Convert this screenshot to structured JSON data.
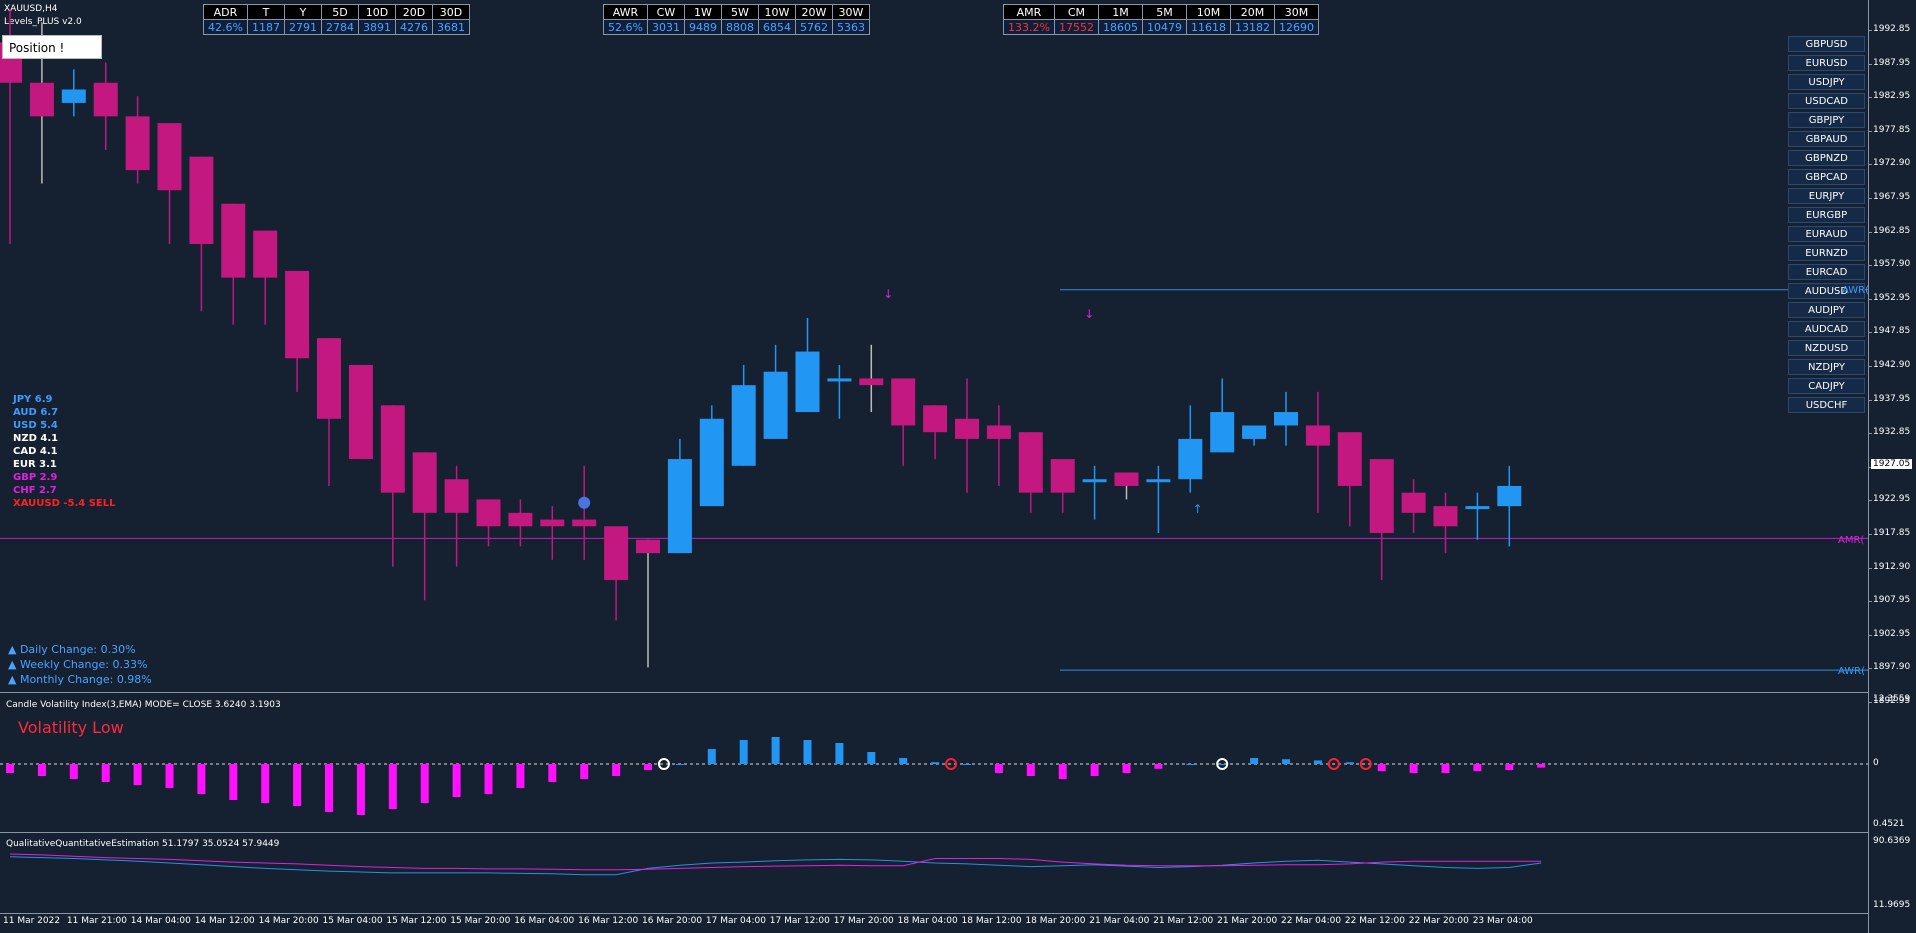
{
  "window": {
    "symbol_title": "XAUUSD,H4",
    "indicator_name": "Levels_PLUS v2.0"
  },
  "position_button": "Position !",
  "tables": {
    "daily": {
      "headers": [
        "ADR",
        "T",
        "Y",
        "5D",
        "10D",
        "20D",
        "30D"
      ],
      "values": [
        "42.6%",
        "1187",
        "2791",
        "2784",
        "3891",
        "4276",
        "3681"
      ]
    },
    "weekly": {
      "headers": [
        "AWR",
        "CW",
        "1W",
        "5W",
        "10W",
        "20W",
        "30W"
      ],
      "values": [
        "52.6%",
        "3031",
        "9489",
        "8808",
        "6854",
        "5762",
        "5363"
      ]
    },
    "monthly": {
      "headers": [
        "AMR",
        "CM",
        "1M",
        "5M",
        "10M",
        "20M",
        "30M"
      ],
      "values": [
        "133.2%",
        "17552",
        "18605",
        "10479",
        "11618",
        "13182",
        "12690"
      ]
    }
  },
  "pairs": [
    "GBPUSD",
    "EURUSD",
    "USDJPY",
    "USDCAD",
    "GBPJPY",
    "GBPAUD",
    "GBPNZD",
    "GBPCAD",
    "EURJPY",
    "EURGBP",
    "EURAUD",
    "EURNZD",
    "EURCAD",
    "AUDUSD",
    "AUDJPY",
    "AUDCAD",
    "NZDUSD",
    "NZDJPY",
    "CADJPY",
    "USDCHF"
  ],
  "strength": [
    {
      "label": "JPY  6.9",
      "color": "#3d9bff"
    },
    {
      "label": "AUD  6.7",
      "color": "#3d9bff"
    },
    {
      "label": "USD  5.4",
      "color": "#3d9bff"
    },
    {
      "label": "NZD  4.1",
      "color": "#ffffff"
    },
    {
      "label": "CAD  4.1",
      "color": "#ffffff"
    },
    {
      "label": "EUR  3.1",
      "color": "#ffffff"
    },
    {
      "label": "GBP  2.9",
      "color": "#e020e0"
    },
    {
      "label": "CHF  2.7",
      "color": "#e020e0"
    },
    {
      "label": "XAUUSD -5.4 SELL",
      "color": "#ff2020"
    }
  ],
  "changes": [
    "▲ Daily Change: 0.30%",
    "▲ Weekly Change: 0.33%",
    "▲ Monthly Change: 0.98%"
  ],
  "price_axis": [
    "1992.85",
    "1987.95",
    "1982.95",
    "1977.85",
    "1972.90",
    "1967.95",
    "1962.85",
    "1957.90",
    "1952.95",
    "1947.85",
    "1942.90",
    "1937.95",
    "1932.85",
    "1927.05",
    "1922.95",
    "1917.85",
    "1912.90",
    "1907.95",
    "1902.95",
    "1897.90",
    "1892.95"
  ],
  "current_price": "1927.05",
  "level_labels": {
    "awr_high": "AWR(",
    "amr": "AMR(",
    "awr_low": "AWR("
  },
  "indicator1": {
    "title": "Candle Volatility Index(3,EMA) MODE= CLOSE 3.6240 3.1903",
    "status": "Volatility Low",
    "axis": [
      "12.3559",
      "0",
      "0.4521"
    ]
  },
  "indicator2": {
    "title": "QualitativeQuantitativeEstimation 51.1797 35.0524 57.9449",
    "axis": [
      "90.6369",
      "11.9695"
    ]
  },
  "time_axis": [
    "11 Mar 2022",
    "11 Mar 21:00",
    "14 Mar 04:00",
    "14 Mar 12:00",
    "14 Mar 20:00",
    "15 Mar 04:00",
    "15 Mar 12:00",
    "15 Mar 20:00",
    "16 Mar 04:00",
    "16 Mar 12:00",
    "16 Mar 20:00",
    "17 Mar 04:00",
    "17 Mar 12:00",
    "17 Mar 20:00",
    "18 Mar 04:00",
    "18 Mar 12:00",
    "18 Mar 20:00",
    "21 Mar 04:00",
    "21 Mar 12:00",
    "21 Mar 20:00",
    "22 Mar 04:00",
    "22 Mar 12:00",
    "22 Mar 20:00",
    "23 Mar 04:00"
  ],
  "colors": {
    "bull": "#2196f3",
    "bear": "#c2187f",
    "background": "#152031",
    "grid_text": "#ffffff"
  },
  "candles": [
    {
      "o": 1991,
      "h": 1996,
      "l": 1961,
      "c": 1985
    },
    {
      "o": 1985,
      "h": 1994,
      "l": 1970,
      "c": 1980
    },
    {
      "o": 1982,
      "h": 1987,
      "l": 1980,
      "c": 1984
    },
    {
      "o": 1985,
      "h": 1988,
      "l": 1975,
      "c": 1980
    },
    {
      "o": 1980,
      "h": 1983,
      "l": 1970,
      "c": 1972
    },
    {
      "o": 1979,
      "h": 1979,
      "l": 1961,
      "c": 1969
    },
    {
      "o": 1974,
      "h": 1974,
      "l": 1951,
      "c": 1961
    },
    {
      "o": 1967,
      "h": 1967,
      "l": 1949,
      "c": 1956
    },
    {
      "o": 1963,
      "h": 1963,
      "l": 1949,
      "c": 1956
    },
    {
      "o": 1957,
      "h": 1957,
      "l": 1939,
      "c": 1944
    },
    {
      "o": 1947,
      "h": 1947,
      "l": 1925,
      "c": 1935
    },
    {
      "o": 1943,
      "h": 1943,
      "l": 1929,
      "c": 1929
    },
    {
      "o": 1937,
      "h": 1937,
      "l": 1913,
      "c": 1924
    },
    {
      "o": 1930,
      "h": 1930,
      "l": 1908,
      "c": 1921
    },
    {
      "o": 1926,
      "h": 1928,
      "l": 1913,
      "c": 1921
    },
    {
      "o": 1923,
      "h": 1923,
      "l": 1916,
      "c": 1919
    },
    {
      "o": 1921,
      "h": 1923,
      "l": 1916,
      "c": 1919
    },
    {
      "o": 1920,
      "h": 1922,
      "l": 1914,
      "c": 1919
    },
    {
      "o": 1920,
      "h": 1928,
      "l": 1914,
      "c": 1919
    },
    {
      "o": 1919,
      "h": 1919,
      "l": 1905,
      "c": 1911
    },
    {
      "o": 1917,
      "h": 1917,
      "l": 1898,
      "c": 1915
    },
    {
      "o": 1915,
      "h": 1932,
      "l": 1915,
      "c": 1929
    },
    {
      "o": 1922,
      "h": 1937,
      "l": 1922,
      "c": 1935
    },
    {
      "o": 1928,
      "h": 1943,
      "l": 1928,
      "c": 1940
    },
    {
      "o": 1932,
      "h": 1946,
      "l": 1932,
      "c": 1942
    },
    {
      "o": 1936,
      "h": 1950,
      "l": 1936,
      "c": 1945
    },
    {
      "o": 1941,
      "h": 1943,
      "l": 1935,
      "c": 1941
    },
    {
      "o": 1941,
      "h": 1946,
      "l": 1936,
      "c": 1940
    },
    {
      "o": 1941,
      "h": 1941,
      "l": 1928,
      "c": 1934
    },
    {
      "o": 1937,
      "h": 1937,
      "l": 1929,
      "c": 1933
    },
    {
      "o": 1935,
      "h": 1941,
      "l": 1924,
      "c": 1932
    },
    {
      "o": 1934,
      "h": 1937,
      "l": 1925,
      "c": 1932
    },
    {
      "o": 1933,
      "h": 1933,
      "l": 1921,
      "c": 1924
    },
    {
      "o": 1929,
      "h": 1929,
      "l": 1921,
      "c": 1924
    },
    {
      "o": 1926,
      "h": 1928,
      "l": 1920,
      "c": 1926
    },
    {
      "o": 1927,
      "h": 1927,
      "l": 1923,
      "c": 1925
    },
    {
      "o": 1926,
      "h": 1928,
      "l": 1918,
      "c": 1926
    },
    {
      "o": 1926,
      "h": 1937,
      "l": 1924,
      "c": 1932
    },
    {
      "o": 1930,
      "h": 1941,
      "l": 1930,
      "c": 1936
    },
    {
      "o": 1932,
      "h": 1934,
      "l": 1931,
      "c": 1934
    },
    {
      "o": 1934,
      "h": 1939,
      "l": 1931,
      "c": 1936
    },
    {
      "o": 1934,
      "h": 1939,
      "l": 1921,
      "c": 1931
    },
    {
      "o": 1933,
      "h": 1933,
      "l": 1919,
      "c": 1925
    },
    {
      "o": 1929,
      "h": 1929,
      "l": 1911,
      "c": 1918
    },
    {
      "o": 1924,
      "h": 1926,
      "l": 1918,
      "c": 1921
    },
    {
      "o": 1922,
      "h": 1924,
      "l": 1915,
      "c": 1919
    },
    {
      "o": 1922,
      "h": 1924,
      "l": 1917,
      "c": 1922
    },
    {
      "o": 1922,
      "h": 1928,
      "l": 1916,
      "c": 1925
    }
  ],
  "volatility": [
    -1.5,
    -2,
    -2.5,
    -3,
    -3.5,
    -4,
    -5,
    -6,
    -6.5,
    -7,
    -8,
    -8.5,
    -7.5,
    -6.5,
    -5.5,
    -5,
    -4,
    -3,
    -2.5,
    -2,
    -1,
    0,
    2.5,
    4,
    4.5,
    4,
    3.5,
    2,
    1,
    0.3,
    0,
    -1.5,
    -2,
    -2.5,
    -2,
    -1.5,
    -0.8,
    0,
    0,
    1,
    0.8,
    0.6,
    0.3,
    -1.2,
    -1.5,
    -1.5,
    -1.2,
    -1,
    -0.6
  ]
}
